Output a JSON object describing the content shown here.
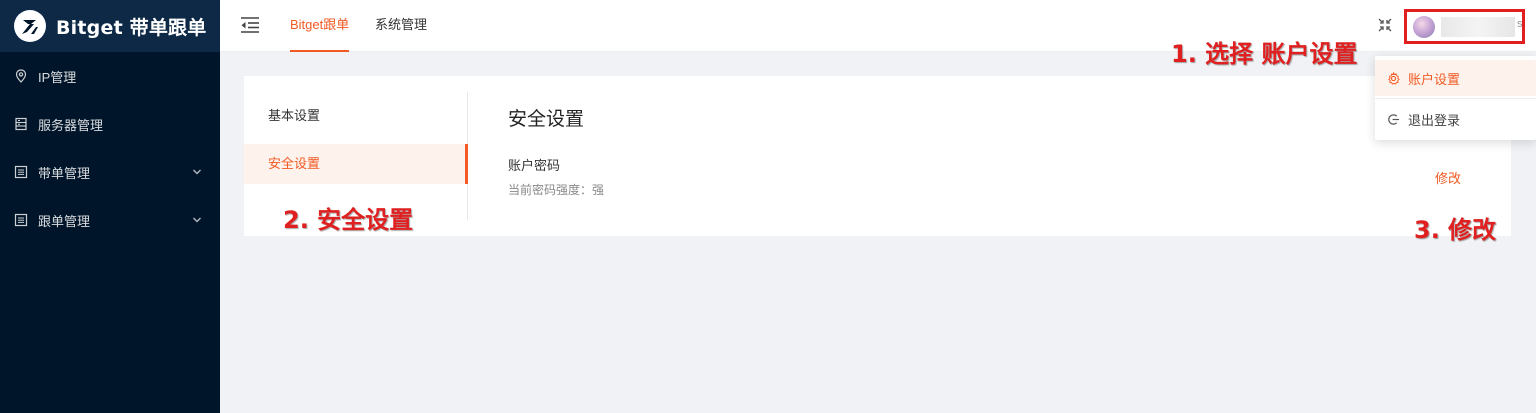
{
  "app": {
    "logo_text": "Bitget 带单跟单"
  },
  "sidebar": {
    "items": [
      {
        "label": "IP管理",
        "icon": "location-pin-icon",
        "expandable": false
      },
      {
        "label": "服务器管理",
        "icon": "server-icon",
        "expandable": false
      },
      {
        "label": "带单管理",
        "icon": "list-icon",
        "expandable": true
      },
      {
        "label": "跟单管理",
        "icon": "list-icon",
        "expandable": true
      }
    ]
  },
  "header": {
    "tabs": [
      {
        "label": "Bitget跟单",
        "active": true
      },
      {
        "label": "系统管理",
        "active": false
      }
    ],
    "user_name_tail": "s"
  },
  "settings": {
    "nav": [
      {
        "label": "基本设置",
        "active": false
      },
      {
        "label": "安全设置",
        "active": true
      }
    ],
    "section_title": "安全设置",
    "password_row": {
      "label": "账户密码",
      "description": "当前密码强度：强",
      "action": "修改"
    }
  },
  "user_menu": {
    "items": [
      {
        "label": "账户设置",
        "icon": "gear-icon",
        "active": true
      },
      {
        "label": "退出登录",
        "icon": "logout-icon",
        "active": false
      }
    ]
  },
  "annotations": {
    "step1": "1. 选择 账户设置",
    "step2": "2. 安全设置",
    "step3": "3. 修改"
  },
  "colors": {
    "accent": "#f15a24",
    "sidebar_bg": "#001529",
    "annotation": "#e02020"
  }
}
